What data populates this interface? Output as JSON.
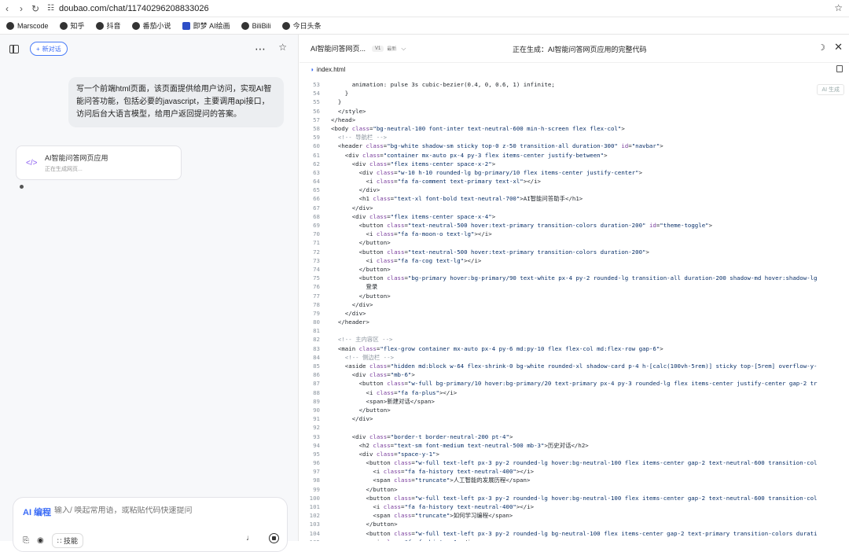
{
  "browser": {
    "url": "doubao.com/chat/11740296208833026",
    "bookmarks": [
      {
        "label": "Marscode",
        "icon": "marscode-icon"
      },
      {
        "label": "知乎",
        "icon": "zhihu-icon"
      },
      {
        "label": "抖音",
        "icon": "douyin-icon"
      },
      {
        "label": "番茄小说",
        "icon": "fanqie-icon"
      },
      {
        "label": "即梦 AI绘画",
        "icon": "jimeng-icon"
      },
      {
        "label": "BiliBili",
        "icon": "bilibili-icon"
      },
      {
        "label": "今日头条",
        "icon": "toutiao-icon"
      }
    ]
  },
  "left": {
    "new_chat_label": "新对话",
    "user_message": "写一个前端html页面，该页面提供给用户访问，实现AI智能问答功能，包括必要的javascript，主要调用api接口，访问后台大语言模型，给用户返回提问的答案。",
    "card_title": "AI智能问答网页应用",
    "card_subtitle": "正在生成网页...",
    "input": {
      "mode_label": "AI 编程",
      "placeholder": "输入/ 唤起常用语，或粘贴代码快速提问",
      "skill_label": "技能"
    }
  },
  "right": {
    "title": "AI智能问答网页...",
    "version": "V1",
    "latest": "最新",
    "status": "正在生成：AI智能问答网页应用的完整代码",
    "file_tab": "index.html",
    "ai_badge": "AI 生成",
    "code": [
      {
        "n": "53",
        "html": "      animation: pulse 3s cubic-bezier(0.4, 0, 0.6, 1) infinite;"
      },
      {
        "n": "54",
        "html": "    }"
      },
      {
        "n": "55",
        "html": "  }"
      },
      {
        "n": "56",
        "html": "  &lt;/style&gt;"
      },
      {
        "n": "57",
        "html": "&lt;/head&gt;"
      },
      {
        "n": "58",
        "html": "&lt;body class=\"bg-neutral-100 font-inter text-neutral-600 min-h-screen flex flex-col\"&gt;"
      },
      {
        "n": "59",
        "html": "  &lt;!-- 导航栏 --&gt;"
      },
      {
        "n": "60",
        "html": "  &lt;header class=\"bg-white shadow-sm sticky top-0 z-50 transition-all duration-300\" id=\"navbar\"&gt;"
      },
      {
        "n": "61",
        "html": "    &lt;div class=\"container mx-auto px-4 py-3 flex items-center justify-between\"&gt;"
      },
      {
        "n": "62",
        "html": "      &lt;div class=\"flex items-center space-x-2\"&gt;"
      },
      {
        "n": "63",
        "html": "        &lt;div class=\"w-10 h-10 rounded-lg bg-primary/10 flex items-center justify-center\"&gt;"
      },
      {
        "n": "64",
        "html": "          &lt;i class=\"fa fa-comment text-primary text-xl\"&gt;&lt;/i&gt;"
      },
      {
        "n": "65",
        "html": "        &lt;/div&gt;"
      },
      {
        "n": "66",
        "html": "        &lt;h1 class=\"text-xl font-bold text-neutral-700\"&gt;AI智能问答助手&lt;/h1&gt;"
      },
      {
        "n": "67",
        "html": "      &lt;/div&gt;"
      },
      {
        "n": "68",
        "html": "      &lt;div class=\"flex items-center space-x-4\"&gt;"
      },
      {
        "n": "69",
        "html": "        &lt;button class=\"text-neutral-500 hover:text-primary transition-colors duration-200\" id=\"theme-toggle\"&gt;"
      },
      {
        "n": "70",
        "html": "          &lt;i class=\"fa fa-moon-o text-lg\"&gt;&lt;/i&gt;"
      },
      {
        "n": "71",
        "html": "        &lt;/button&gt;"
      },
      {
        "n": "72",
        "html": "        &lt;button class=\"text-neutral-500 hover:text-primary transition-colors duration-200\"&gt;"
      },
      {
        "n": "73",
        "html": "          &lt;i class=\"fa fa-cog text-lg\"&gt;&lt;/i&gt;"
      },
      {
        "n": "74",
        "html": "        &lt;/button&gt;"
      },
      {
        "n": "75",
        "html": "        &lt;button class=\"bg-primary hover:bg-primary/90 text-white px-4 py-2 rounded-lg transition-all duration-200 shadow-md hover:shadow-lg"
      },
      {
        "n": "76",
        "html": "          登录"
      },
      {
        "n": "77",
        "html": "        &lt;/button&gt;"
      },
      {
        "n": "78",
        "html": "      &lt;/div&gt;"
      },
      {
        "n": "79",
        "html": "    &lt;/div&gt;"
      },
      {
        "n": "80",
        "html": "  &lt;/header&gt;"
      },
      {
        "n": "81",
        "html": ""
      },
      {
        "n": "82",
        "html": "  &lt;!-- 主内容区 --&gt;"
      },
      {
        "n": "83",
        "html": "  &lt;main class=\"flex-grow container mx-auto px-4 py-6 md:py-10 flex flex-col md:flex-row gap-6\"&gt;"
      },
      {
        "n": "84",
        "html": "    &lt;!-- 侧边栏 --&gt;"
      },
      {
        "n": "85",
        "html": "    &lt;aside class=\"hidden md:block w-64 flex-shrink-0 bg-white rounded-xl shadow-card p-4 h-[calc(100vh-5rem)] sticky top-[5rem] overflow-y-"
      },
      {
        "n": "86",
        "html": "      &lt;div class=\"mb-6\"&gt;"
      },
      {
        "n": "87",
        "html": "        &lt;button class=\"w-full bg-primary/10 hover:bg-primary/20 text-primary px-4 py-3 rounded-lg flex items-center justify-center gap-2 tr"
      },
      {
        "n": "88",
        "html": "          &lt;i class=\"fa fa-plus\"&gt;&lt;/i&gt;"
      },
      {
        "n": "89",
        "html": "          &lt;span&gt;新建对话&lt;/span&gt;"
      },
      {
        "n": "90",
        "html": "        &lt;/button&gt;"
      },
      {
        "n": "91",
        "html": "      &lt;/div&gt;"
      },
      {
        "n": "92",
        "html": ""
      },
      {
        "n": "93",
        "html": "      &lt;div class=\"border-t border-neutral-200 pt-4\"&gt;"
      },
      {
        "n": "94",
        "html": "        &lt;h2 class=\"text-sm font-medium text-neutral-500 mb-3\"&gt;历史对话&lt;/h2&gt;"
      },
      {
        "n": "95",
        "html": "        &lt;div class=\"space-y-1\"&gt;"
      },
      {
        "n": "96",
        "html": "          &lt;button class=\"w-full text-left px-3 py-2 rounded-lg hover:bg-neutral-100 flex items-center gap-2 text-neutral-600 transition-col"
      },
      {
        "n": "97",
        "html": "            &lt;i class=\"fa fa-history text-neutral-400\"&gt;&lt;/i&gt;"
      },
      {
        "n": "98",
        "html": "            &lt;span class=\"truncate\"&gt;人工智能的发展历程&lt;/span&gt;"
      },
      {
        "n": "99",
        "html": "          &lt;/button&gt;"
      },
      {
        "n": "100",
        "html": "          &lt;button class=\"w-full text-left px-3 py-2 rounded-lg hover:bg-neutral-100 flex items-center gap-2 text-neutral-600 transition-col"
      },
      {
        "n": "101",
        "html": "            &lt;i class=\"fa fa-history text-neutral-400\"&gt;&lt;/i&gt;"
      },
      {
        "n": "102",
        "html": "            &lt;span class=\"truncate\"&gt;如何学习编程&lt;/span&gt;"
      },
      {
        "n": "103",
        "html": "          &lt;/button&gt;"
      },
      {
        "n": "104",
        "html": "          &lt;button class=\"w-full text-left px-3 py-2 rounded-lg bg-neutral-100 flex items-center gap-2 text-primary transition-colors durati"
      },
      {
        "n": "105",
        "html": "            &lt;i class=\"fa fa-history\"&gt;&lt;/i&gt;"
      }
    ]
  }
}
